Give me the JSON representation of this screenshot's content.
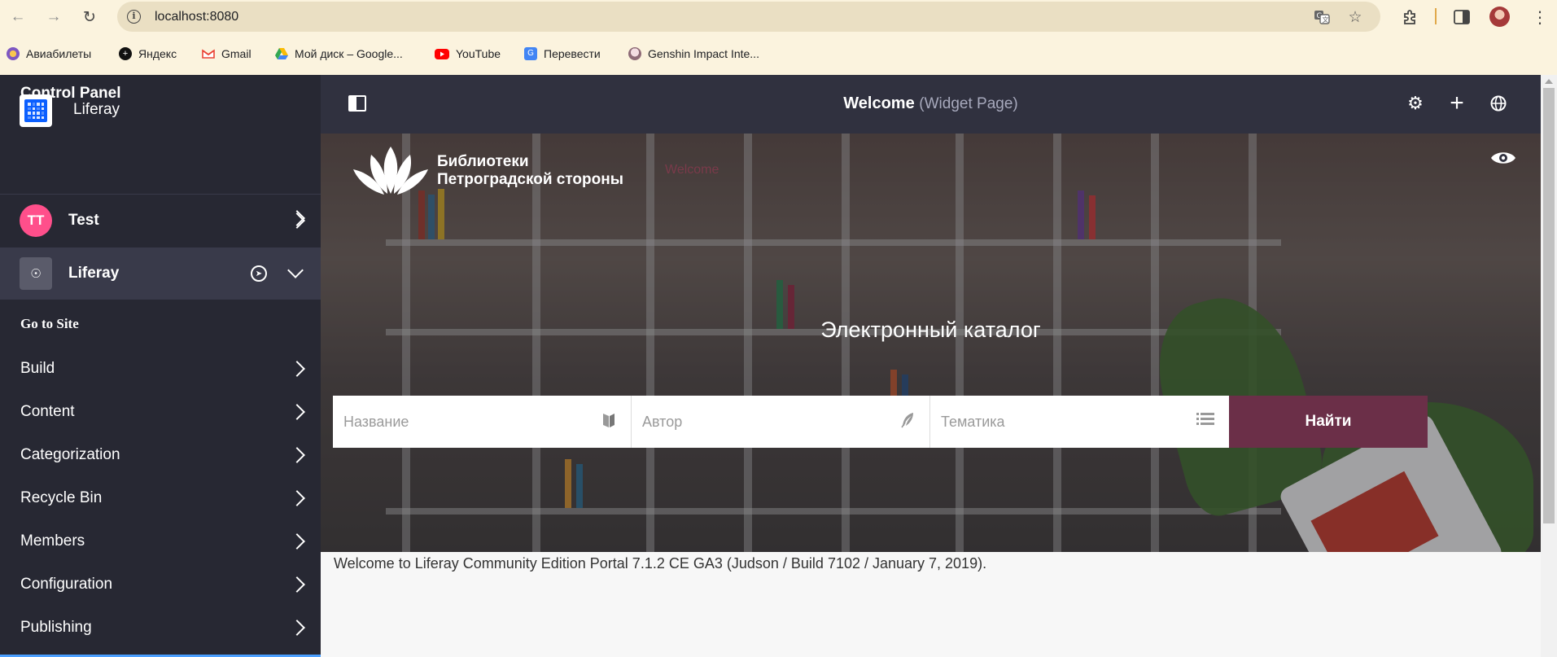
{
  "browser": {
    "url": "localhost:8080",
    "bookmarks": [
      {
        "label": "Авиабилеты",
        "icon": "globe-icon",
        "color": "#7e57c2"
      },
      {
        "label": "Яндекс",
        "icon": "yandex-icon",
        "color": "#111111"
      },
      {
        "label": "Gmail",
        "icon": "gmail-icon",
        "color": "#ea4335"
      },
      {
        "label": "Мой диск – Google...",
        "icon": "drive-icon",
        "color": "#34a853"
      },
      {
        "label": "YouTube",
        "icon": "youtube-icon",
        "color": "#ff0000"
      },
      {
        "label": "Перевести",
        "icon": "translate-icon",
        "color": "#4285f4"
      },
      {
        "label": "Genshin Impact Inte...",
        "icon": "genshin-icon",
        "color": "#c9a8b4"
      }
    ]
  },
  "sidebar": {
    "brand": "Liferay",
    "control_panel": "Control Panel",
    "test": {
      "avatar": "TT",
      "label": "Test",
      "avatar_color": "#ff4f8b"
    },
    "site": {
      "label": "Liferay"
    },
    "go_to_site": "Go to Site",
    "items": [
      {
        "label": "Build"
      },
      {
        "label": "Content"
      },
      {
        "label": "Categorization"
      },
      {
        "label": "Recycle Bin"
      },
      {
        "label": "Members"
      },
      {
        "label": "Configuration"
      },
      {
        "label": "Publishing"
      }
    ]
  },
  "topbar": {
    "title": "Welcome",
    "subtitle": "(Widget Page)"
  },
  "hero": {
    "library_name_line1": "Библиотеки",
    "library_name_line2": "Петроградской стороны",
    "faint_text": "Welcome",
    "catalog_title": "Электронный каталог",
    "search": {
      "title_placeholder": "Название",
      "author_placeholder": "Автор",
      "topic_placeholder": "Тематика",
      "button_label": "Найти",
      "button_color": "#6b2f48"
    }
  },
  "footer_text": "Welcome to Liferay Community Edition Portal 7.1.2 CE GA3 (Judson / Build 7102 / January 7, 2019)."
}
